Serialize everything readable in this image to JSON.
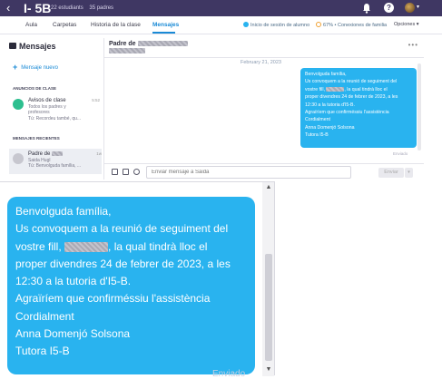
{
  "header": {
    "back_icon": "chevron-left-icon",
    "class_name": "I- 5B",
    "students": "22 estudiants",
    "parents": "35 padres",
    "colors": {
      "bar": "#3f3763",
      "accent": "#1a8ad6",
      "bubble": "#29b3ef"
    }
  },
  "tabs": {
    "items": [
      {
        "label": "Aula"
      },
      {
        "label": "Carpetas"
      },
      {
        "label": "Historia de la clase"
      },
      {
        "label": "Mensajes",
        "active": true
      }
    ],
    "student_login": "Inicio de sesión de alumno",
    "family_connections": "67% • Conexiones de familia",
    "options": "Opciones"
  },
  "sidebar": {
    "title": "Mensajes",
    "new_message": "Mensaje nuevo",
    "announcements_header": "ANUNCIOS DE CLASE",
    "announcement": {
      "title": "Avisos de clase",
      "time": "5:52",
      "line1": "Todos los padres y",
      "line2": "profesores",
      "preview": "Tú: Recordeu també, qu..."
    },
    "recent_header": "MENSAJES RECIENTES",
    "recent": {
      "name": "Padre de",
      "time": "1w",
      "line1": "Saida Hugl",
      "preview": "Tú: Benvolguda família, ..."
    }
  },
  "conversation": {
    "title": "Padre de",
    "date": "February 21, 2023",
    "small_message_lines": [
      "Benvolguda família,",
      "Us convoquem a la reunió de seguiment del",
      "vostre fill,",
      ", la qual tindrà lloc el",
      "proper divendres 24 de febrer de 2023, a les",
      "12:30 a la tutoria d'I5-B.",
      "Agraïríem que confirméssiu l'assistència",
      "Cordialment",
      "Anna Domenjó Solsona",
      "Tutora I5-B"
    ],
    "status": "Enviado",
    "compose_placeholder": "Enviar mensaje a Saida",
    "send_label": "Enviar"
  },
  "zoom": {
    "lines": [
      "Benvolguda família,",
      "Us convoquem a la reunió de seguiment del",
      "vostre fill,",
      ", la qual tindrà lloc el",
      "proper divendres 24 de febrer de 2023, a les",
      "12:30 a la tutoria d'I5-B.",
      "Agraïríem que confirméssiu l'assistència",
      "Cordialment",
      "Anna Domenjó Solsona",
      "Tutora I5-B"
    ],
    "status": "Enviado"
  }
}
